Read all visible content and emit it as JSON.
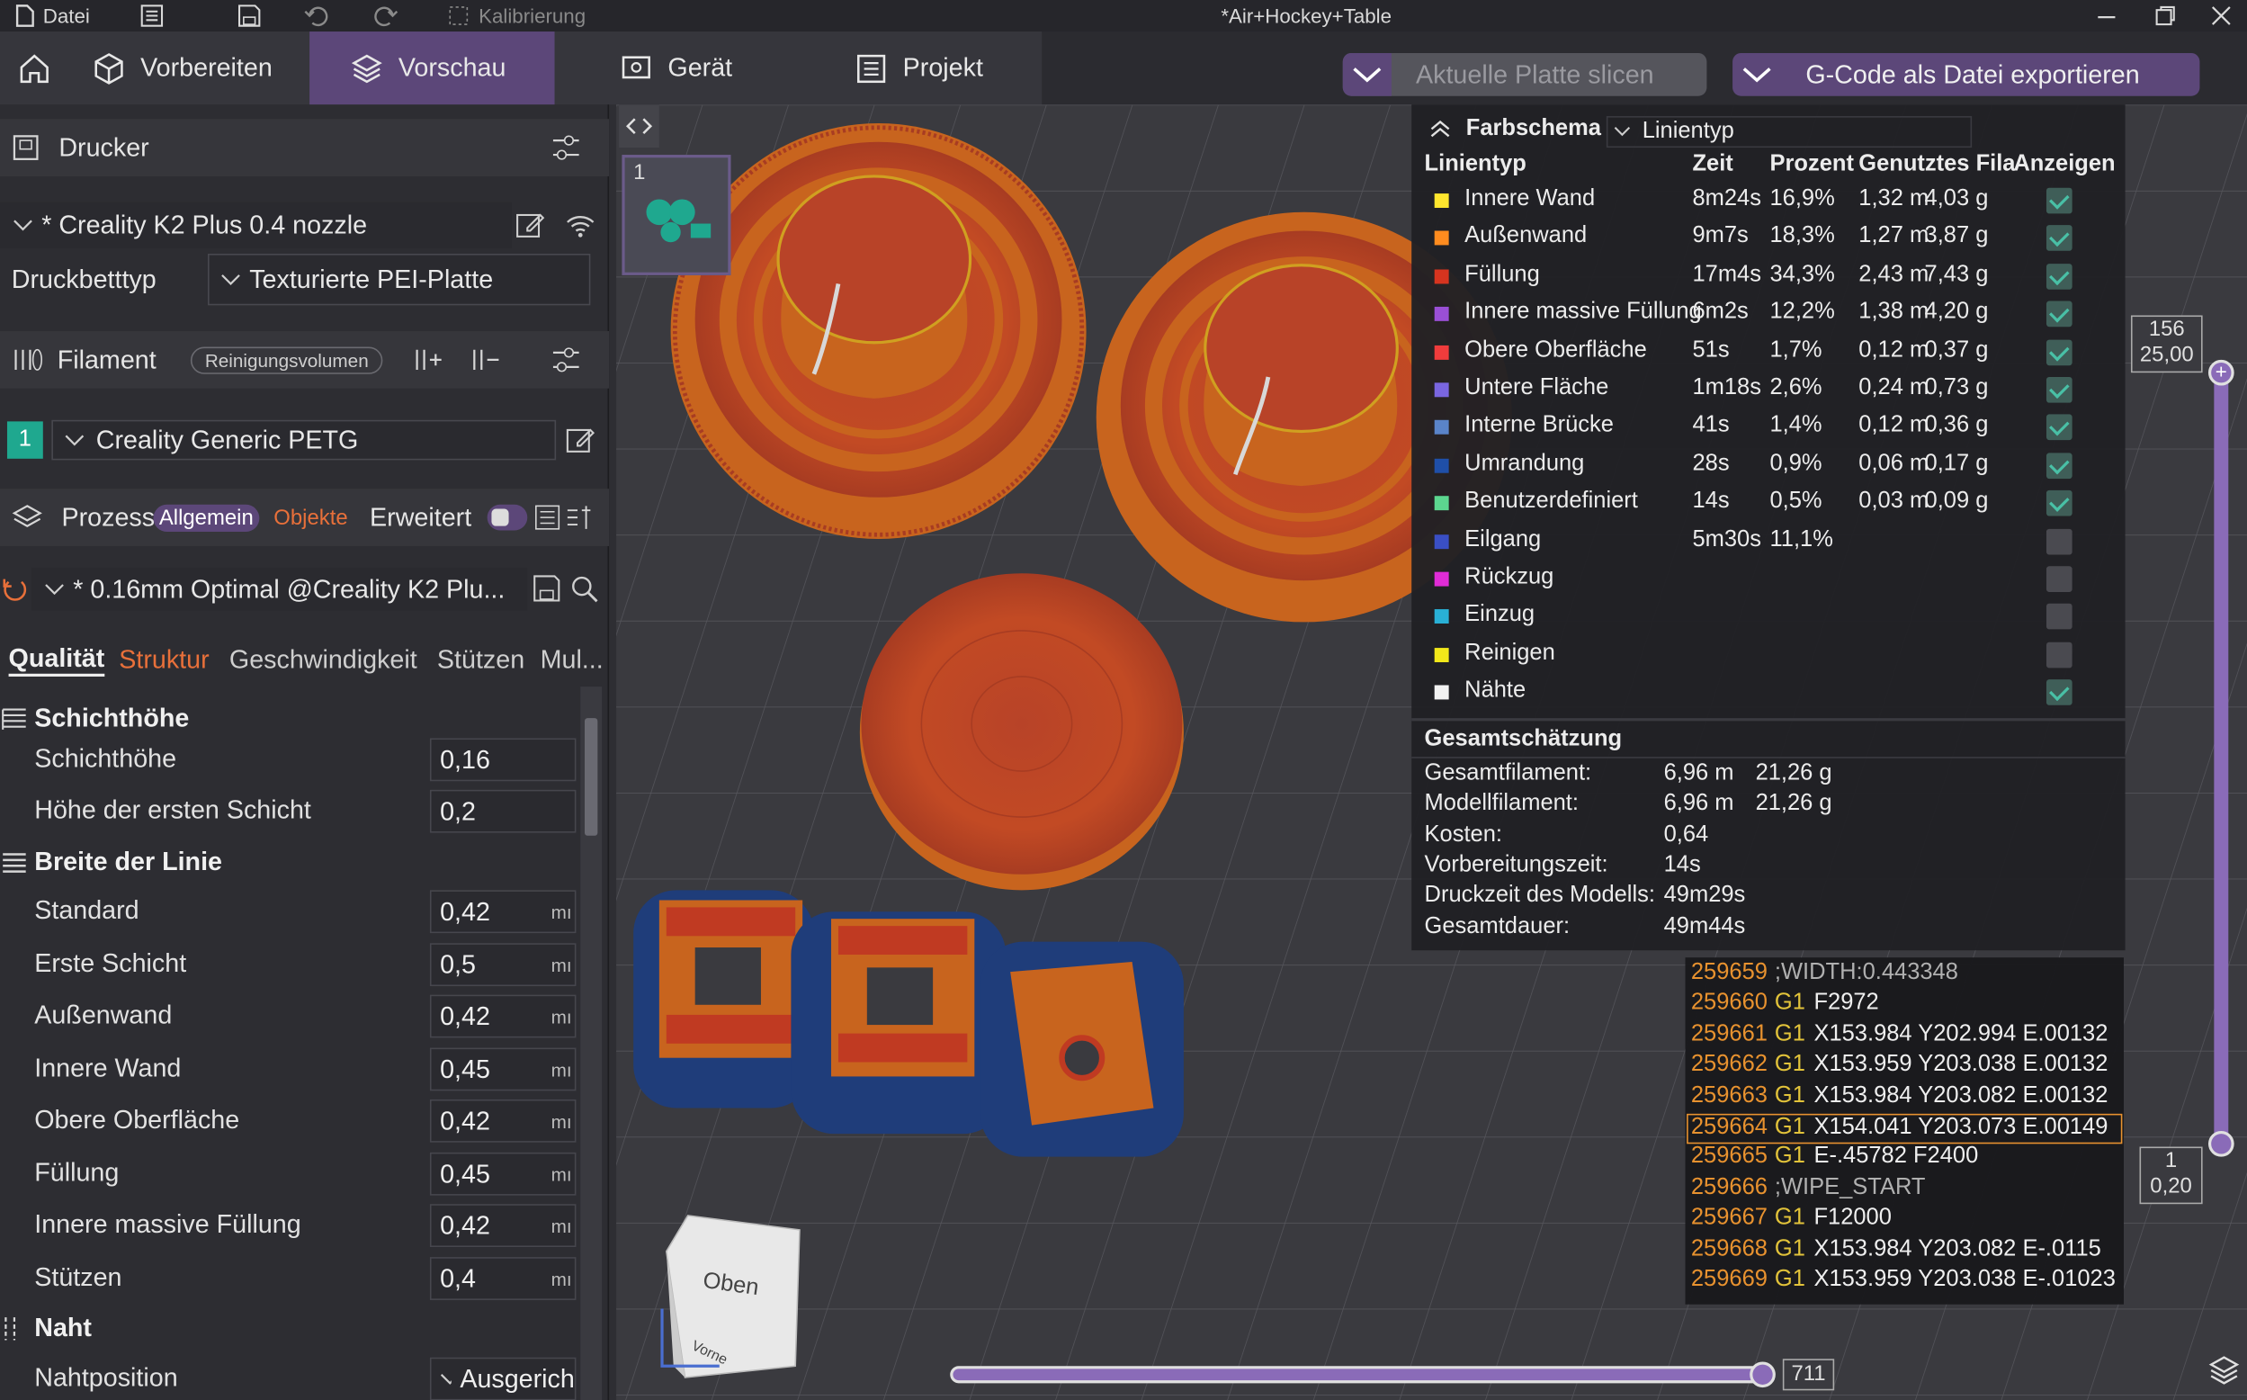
{
  "titlebar": {
    "file_label": "Datei",
    "calibration_label": "Kalibrierung",
    "document_title": "*Air+Hockey+Table"
  },
  "navbar": {
    "tabs": [
      {
        "label": "Vorbereiten",
        "icon": "cube-icon",
        "active": false
      },
      {
        "label": "Vorschau",
        "icon": "layers-icon",
        "active": true
      },
      {
        "label": "Gerät",
        "icon": "monitor-icon",
        "active": false
      },
      {
        "label": "Projekt",
        "icon": "list-icon",
        "active": false
      }
    ],
    "slice_button": "Aktuelle Platte slicen",
    "export_button": "G-Code als Datei exportieren"
  },
  "sidebar": {
    "printer_header": "Drucker",
    "printer_preset": "* Creality K2 Plus 0.4 nozzle",
    "bed_type_label": "Druckbetttyp",
    "bed_type_value": "Texturierte PEI-Platte",
    "filament_header": "Filament",
    "purge_button": "Reinigungsvolumen",
    "filament_index": "1",
    "filament_value": "Creality Generic PETG",
    "process_header": "Prozess",
    "process_tabs": {
      "general": "Allgemein",
      "objects": "Objekte",
      "advanced": "Erweitert"
    },
    "process_preset": "* 0.16mm Optimal @Creality K2 Plu...",
    "settings_tabs": [
      {
        "label": "Qualität",
        "state": "active"
      },
      {
        "label": "Struktur",
        "state": "modified"
      },
      {
        "label": "Geschwindigkeit",
        "state": "normal"
      },
      {
        "label": "Stützen",
        "state": "normal"
      },
      {
        "label": "Mul...",
        "state": "normal"
      }
    ],
    "groups": {
      "layer_height": "Schichthöhe",
      "line_width": "Breite der Linie",
      "seam": "Naht"
    },
    "params": {
      "layer_height": {
        "label": "Schichthöhe",
        "value": "0,16",
        "unit": ""
      },
      "first_layer_height": {
        "label": "Höhe der ersten Schicht",
        "value": "0,2",
        "unit": ""
      },
      "standard": {
        "label": "Standard",
        "value": "0,42",
        "unit": "mı"
      },
      "first_layer": {
        "label": "Erste Schicht",
        "value": "0,5",
        "unit": "mı"
      },
      "outer_wall": {
        "label": "Außenwand",
        "value": "0,42",
        "unit": "mı"
      },
      "inner_wall": {
        "label": "Innere Wand",
        "value": "0,45",
        "unit": "mı"
      },
      "top_surface": {
        "label": "Obere Oberfläche",
        "value": "0,42",
        "unit": "mı"
      },
      "infill": {
        "label": "Füllung",
        "value": "0,45",
        "unit": "mı"
      },
      "solid_infill": {
        "label": "Innere massive Füllung",
        "value": "0,42",
        "unit": "mı"
      },
      "support": {
        "label": "Stützen",
        "value": "0,4",
        "unit": "mı"
      },
      "seam_position": {
        "label": "Nahtposition",
        "value": "Ausgerich"
      }
    }
  },
  "viewport": {
    "plate_number": "1",
    "layer_slider": {
      "top_layer": "156",
      "top_height": "25,00",
      "bottom_layer": "1",
      "bottom_height": "0,20"
    },
    "move_slider": {
      "value": "711"
    },
    "view_cube": {
      "top": "Oben",
      "front": "Vorne"
    }
  },
  "legend": {
    "color_scheme_label": "Farbschema",
    "color_scheme_value": "Linientyp",
    "columns": {
      "type": "Linientyp",
      "time": "Zeit",
      "percent": "Prozent",
      "filament": "Genutztes Filament",
      "show": "Anzeigen"
    },
    "rows": [
      {
        "name": "Innere Wand",
        "color": "#ffe62e",
        "time": "8m24s",
        "percent": "16,9%",
        "length": "1,32 m",
        "weight": "4,03 g",
        "shown": true
      },
      {
        "name": "Außenwand",
        "color": "#ff8c1f",
        "time": "9m7s",
        "percent": "18,3%",
        "length": "1,27 m",
        "weight": "3,87 g",
        "shown": true
      },
      {
        "name": "Füllung",
        "color": "#d6341f",
        "time": "17m4s",
        "percent": "34,3%",
        "length": "2,43 m",
        "weight": "7,43 g",
        "shown": true
      },
      {
        "name": "Innere massive Füllung",
        "color": "#9a4fd6",
        "time": "6m2s",
        "percent": "12,2%",
        "length": "1,38 m",
        "weight": "4,20 g",
        "shown": true
      },
      {
        "name": "Obere Oberfläche",
        "color": "#f03c3c",
        "time": "51s",
        "percent": "1,7%",
        "length": "0,12 m",
        "weight": "0,37 g",
        "shown": true
      },
      {
        "name": "Untere Fläche",
        "color": "#7a66e0",
        "time": "1m18s",
        "percent": "2,6%",
        "length": "0,24 m",
        "weight": "0,73 g",
        "shown": true
      },
      {
        "name": "Interne Brücke",
        "color": "#5a84c9",
        "time": "41s",
        "percent": "1,4%",
        "length": "0,12 m",
        "weight": "0,36 g",
        "shown": true
      },
      {
        "name": "Umrandung",
        "color": "#1f4fa8",
        "time": "28s",
        "percent": "0,9%",
        "length": "0,06 m",
        "weight": "0,17 g",
        "shown": true
      },
      {
        "name": "Benutzerdefiniert",
        "color": "#5cd68f",
        "time": "14s",
        "percent": "0,5%",
        "length": "0,03 m",
        "weight": "0,09 g",
        "shown": true
      },
      {
        "name": "Eilgang",
        "color": "#3a4fc4",
        "time": "5m30s",
        "percent": "11,1%",
        "length": "",
        "weight": "",
        "shown": false
      },
      {
        "name": "Rückzug",
        "color": "#e02cd6",
        "time": "",
        "percent": "",
        "length": "",
        "weight": "",
        "shown": false
      },
      {
        "name": "Einzug",
        "color": "#29b0d6",
        "time": "",
        "percent": "",
        "length": "",
        "weight": "",
        "shown": false
      },
      {
        "name": "Reinigen",
        "color": "#f2e81a",
        "time": "",
        "percent": "",
        "length": "",
        "weight": "",
        "shown": false
      },
      {
        "name": "Nähte",
        "color": "#f2f2f2",
        "time": "",
        "percent": "",
        "length": "",
        "weight": "",
        "shown": true
      }
    ],
    "summary_title": "Gesamtschätzung",
    "summary": [
      {
        "label": "Gesamtfilament:",
        "value": "6,96 m",
        "extra": "21,26 g"
      },
      {
        "label": "Modellfilament:",
        "value": "6,96 m",
        "extra": "21,26 g"
      },
      {
        "label": "Kosten:",
        "value": "0,64",
        "extra": ""
      },
      {
        "label": "Vorbereitungszeit:",
        "value": "14s",
        "extra": ""
      },
      {
        "label": "Druckzeit des Modells:",
        "value": "49m29s",
        "extra": ""
      },
      {
        "label": "Gesamtdauer:",
        "value": "49m44s",
        "extra": ""
      }
    ]
  },
  "gcode": [
    {
      "num": "259659",
      "cmd": "",
      "rest": ";WIDTH:0.443348"
    },
    {
      "num": "259660",
      "cmd": "G1",
      "rest": "F2972"
    },
    {
      "num": "259661",
      "cmd": "G1",
      "rest": "X153.984 Y202.994 E.00132"
    },
    {
      "num": "259662",
      "cmd": "G1",
      "rest": "X153.959 Y203.038 E.00132"
    },
    {
      "num": "259663",
      "cmd": "G1",
      "rest": "X153.984 Y203.082 E.00132"
    },
    {
      "num": "259664",
      "cmd": "G1",
      "rest": "X154.041 Y203.073 E.00149",
      "current": true
    },
    {
      "num": "259665",
      "cmd": "G1",
      "rest": "E-.45782 F2400"
    },
    {
      "num": "259666",
      "cmd": "",
      "rest": ";WIPE_START"
    },
    {
      "num": "259667",
      "cmd": "G1",
      "rest": "F12000"
    },
    {
      "num": "259668",
      "cmd": "G1",
      "rest": "X153.984 Y203.082 E-.0115"
    },
    {
      "num": "259669",
      "cmd": "G1",
      "rest": "X153.959 Y203.038 E-.01023"
    }
  ],
  "colors": {
    "accent": "#5c4779",
    "accent_light": "#8a6bb8",
    "modified": "#e8703a",
    "model_orange": "#c8641e",
    "model_red": "#c03a22",
    "brim_blue": "#1f3d7a"
  }
}
